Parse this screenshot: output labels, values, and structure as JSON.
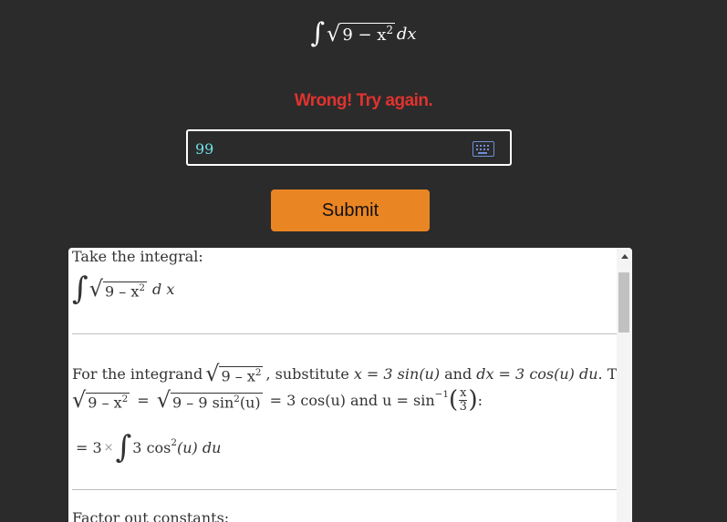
{
  "problem": {
    "integral_symbol": "∫",
    "radicand": "9 − x",
    "exp": "2",
    "differential": "dx"
  },
  "feedback": {
    "message": "Wrong! Try again.",
    "color": "#e0332f"
  },
  "answer_input": {
    "value": "99",
    "keyboard_icon": "keyboard-icon"
  },
  "submit_button": {
    "label": "Submit",
    "color": "#ea8524"
  },
  "solution": {
    "step1_label": "Take the integral:",
    "step1_radicand": "9 – x",
    "step1_exp": "2",
    "step1_diff": "d x",
    "step2_text_a": "For the integrand",
    "step2_radicand": "9 – x",
    "step2_exp": "2",
    "step2_text_b": ", substitute",
    "step2_sub_x": "x = 3 sin(u)",
    "step2_and": "and",
    "step2_sub_dx": "dx = 3 cos(u) du",
    "step2_then": ". Then",
    "step2_line2_lhs_radicand": "9 – x",
    "step2_line2_lhs_exp": "2",
    "step2_line2_eq": "=",
    "step2_line2_mid_radicand": "9 – 9 sin",
    "step2_line2_mid_exp": "2",
    "step2_line2_mid_tail": "(u)",
    "step2_line2_eq2": "= 3 cos(u)",
    "step2_line2_and": "and",
    "step2_line2_u": "u = sin",
    "step2_line2_inv": "−1",
    "step2_line2_frac_num": "x",
    "step2_line2_frac_den": "3",
    "step2_line2_colon": ":",
    "step3_prefix": "= 3",
    "step3_times": "×",
    "step3_integrand": "3 cos",
    "step3_exp": "2",
    "step3_tail": "(u) du",
    "step4_label": "Factor out constants:"
  },
  "scrollbar": {
    "position": 0.1
  }
}
